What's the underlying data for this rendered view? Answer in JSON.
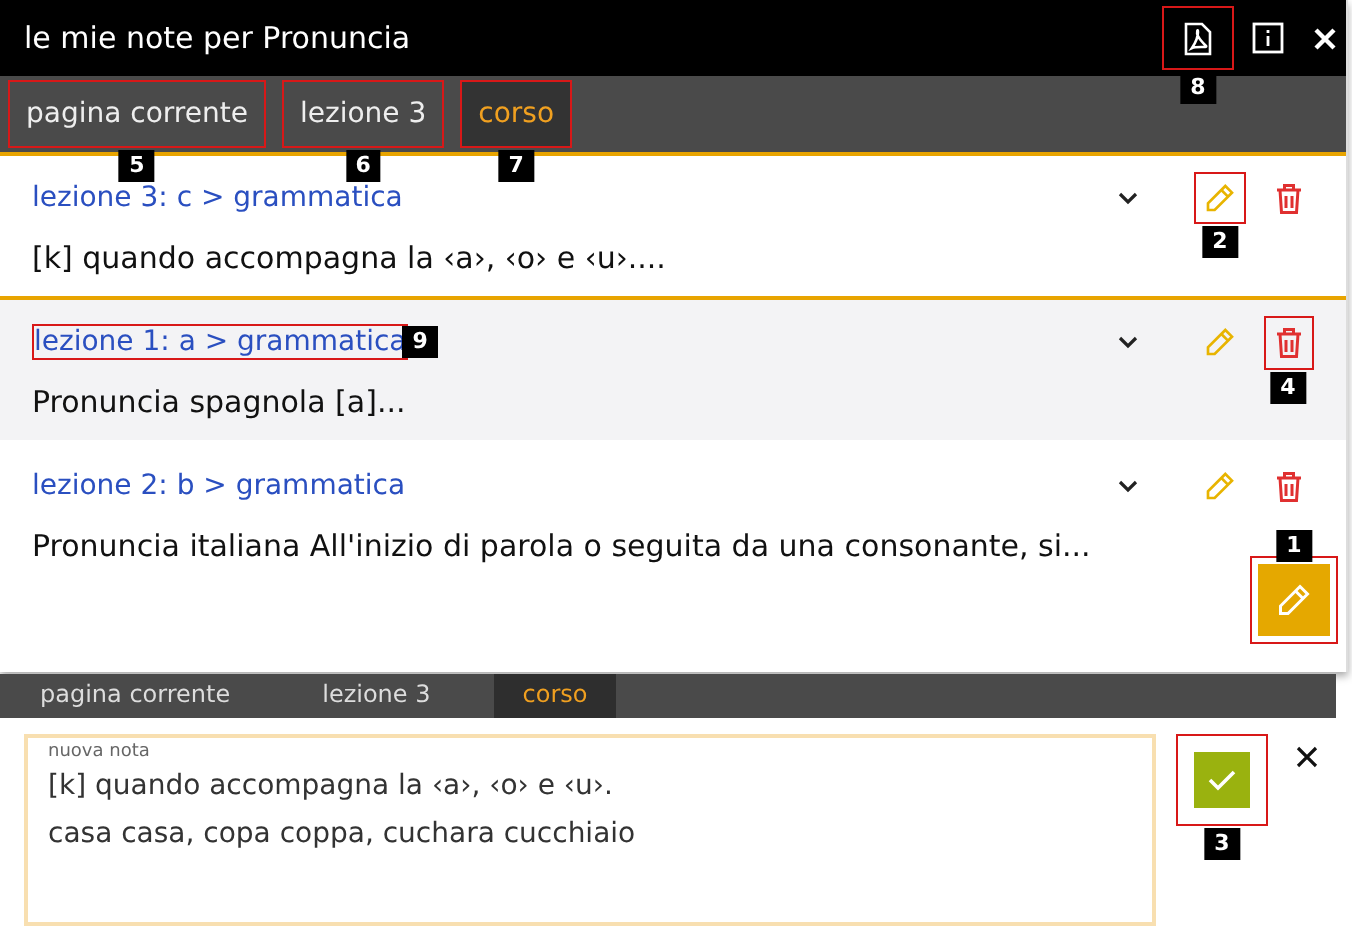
{
  "window": {
    "title": "le mie note per Pronuncia",
    "buttons": [
      {
        "kind": "pdf",
        "callout": "8"
      },
      {
        "kind": "info"
      },
      {
        "kind": "close"
      }
    ]
  },
  "tabs": [
    {
      "label": "pagina corrente",
      "selected": false,
      "callout": "5"
    },
    {
      "label": "lezione 3",
      "selected": false,
      "callout": "6"
    },
    {
      "label": "corso",
      "selected": true,
      "callout": "7"
    }
  ],
  "notes": [
    {
      "title": "lezione 3: c > grammatica",
      "text": "[k] quando accompagna la ‹a›, ‹o› e ‹u›....",
      "highlighted": true,
      "shaded": false,
      "edit_callout": "2"
    },
    {
      "title": "lezione 1: a > grammatica",
      "text": "Pronuncia spagnola [a]...",
      "highlighted": false,
      "shaded": true,
      "title_callout": "9",
      "delete_callout": "4"
    },
    {
      "title": "lezione 2: b > grammatica",
      "text": "Pronuncia italiana All'inizio di parola o seguita da una consonante, si...",
      "highlighted": false,
      "shaded": false
    }
  ],
  "floating_edit": {
    "callout": "1"
  },
  "editor": {
    "tabs": [
      {
        "label": "pagina corrente",
        "selected": false
      },
      {
        "label": "lezione 3",
        "selected": false
      },
      {
        "label": "corso",
        "selected": true
      }
    ],
    "label": "nuova nota",
    "lines": [
      "[k] quando accompagna la ‹a›, ‹o› e ‹u›.",
      "casa casa, copa coppa, cuchara cucchiaio"
    ],
    "confirm_callout": "3"
  }
}
